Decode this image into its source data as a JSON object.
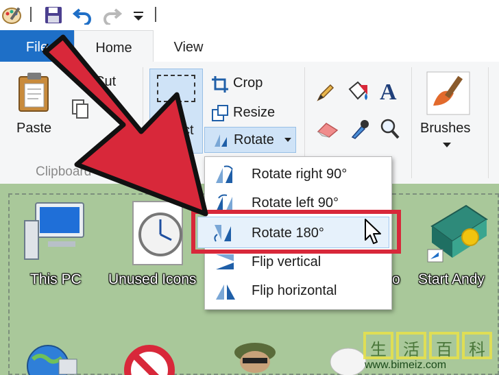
{
  "tabs": {
    "file": "File",
    "home": "Home",
    "view": "View"
  },
  "clipboard": {
    "paste": "Paste",
    "cut": "Cut",
    "group_label": "Clipboard"
  },
  "image": {
    "select": "Select",
    "crop": "Crop",
    "resize": "Resize",
    "rotate": "Rotate"
  },
  "tools": {
    "text_glyph": "A"
  },
  "brushes": {
    "label": "Brushes"
  },
  "rotate_menu": {
    "items": [
      {
        "label": "Rotate right 90°",
        "icon": "rotate-right-icon"
      },
      {
        "label": "Rotate left 90°",
        "icon": "rotate-left-icon"
      },
      {
        "label": "Rotate 180°",
        "icon": "rotate-180-icon"
      },
      {
        "label": "Flip vertical",
        "icon": "flip-vertical-icon"
      },
      {
        "label": "Flip horizontal",
        "icon": "flip-horizontal-icon"
      }
    ],
    "selected_index": 2
  },
  "desktop": {
    "icons": [
      {
        "label": "This PC",
        "icon": "computer-icon"
      },
      {
        "label": "Unused Icons",
        "icon": "clock-icon"
      },
      {
        "label": "o",
        "icon": "partial-icon"
      },
      {
        "label": "Start Andy",
        "icon": "andy-icon"
      }
    ]
  },
  "watermark": {
    "chars": [
      "生",
      "活",
      "百",
      "科"
    ],
    "url": "www.bimeiz.com"
  },
  "colors": {
    "file_tab": "#1e6fc7",
    "arrow": "#d8283a",
    "highlight_border": "#d8283a",
    "canvas": "#a9c89a",
    "menu_hover": "#e6f1fb"
  }
}
